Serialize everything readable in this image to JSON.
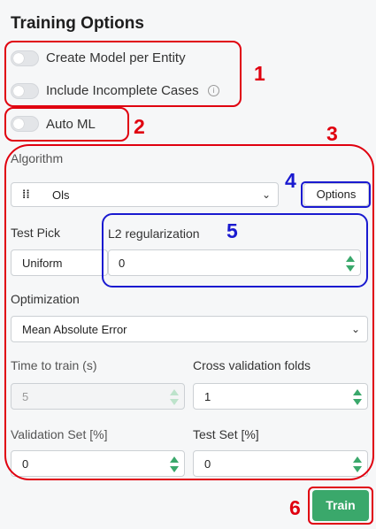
{
  "panel": {
    "title": "Training Options"
  },
  "toggles": {
    "create_model": {
      "label": "Create Model per Entity",
      "on": false
    },
    "include_incomplete": {
      "label": "Include Incomplete Cases",
      "on": false,
      "info_icon": "info-icon"
    },
    "auto_ml": {
      "label": "Auto ML",
      "on": false
    }
  },
  "algorithm": {
    "label": "Algorithm",
    "value": "Ols",
    "icon": "drag-handle-icon",
    "options_button": "Options"
  },
  "test_pick": {
    "label": "Test Pick",
    "value": "Uniform"
  },
  "l2": {
    "label": "L2 regularization",
    "value": "0"
  },
  "optimization": {
    "label": "Optimization",
    "value": "Mean Absolute Error"
  },
  "time_to_train": {
    "label": "Time to train (s)",
    "value": "5"
  },
  "cv_folds": {
    "label": "Cross validation folds",
    "value": "1"
  },
  "validation_set": {
    "label": "Validation Set [%]",
    "value": "0"
  },
  "test_set": {
    "label": "Test Set [%]",
    "value": "0"
  },
  "train_button": "Train",
  "callouts": [
    "1",
    "2",
    "3",
    "4",
    "5",
    "6"
  ],
  "colors": {
    "accent": "#3aa86b",
    "annotation_red": "#e0000f",
    "annotation_blue": "#1a1ad0"
  }
}
